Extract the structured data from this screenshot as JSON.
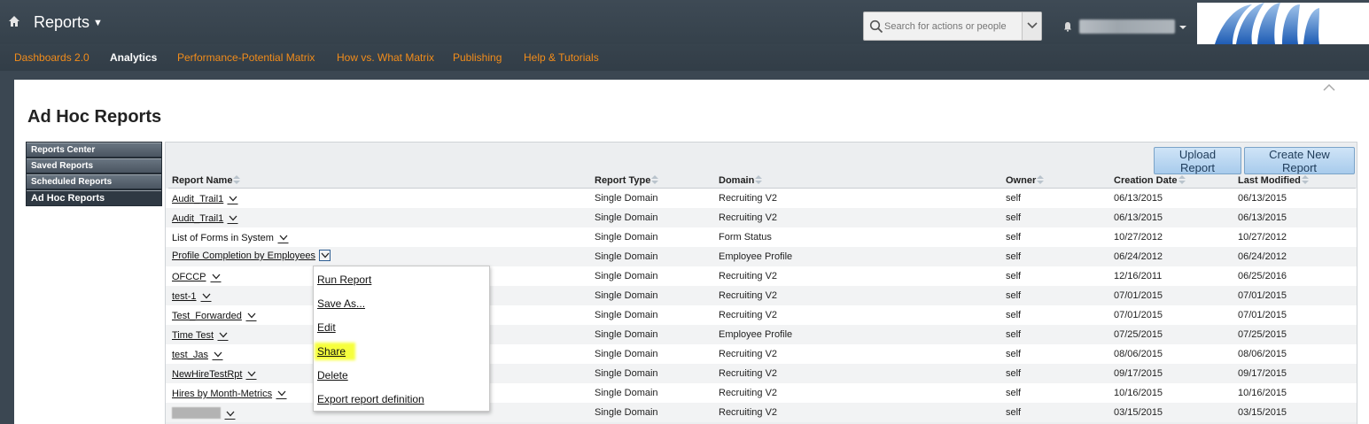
{
  "header": {
    "app_title": "Reports",
    "search_placeholder": "Search for actions or people"
  },
  "nav": {
    "items": [
      {
        "label": "Dashboards 2.0",
        "active": false
      },
      {
        "label": "Analytics",
        "active": true
      },
      {
        "label": "Performance-Potential Matrix",
        "active": false
      },
      {
        "label": "How vs. What Matrix",
        "active": false
      },
      {
        "label": "Publishing",
        "active": false
      },
      {
        "label": "Help & Tutorials",
        "active": false
      }
    ]
  },
  "page": {
    "title": "Ad Hoc Reports"
  },
  "side_menu": {
    "items": [
      {
        "label": "Reports Center"
      },
      {
        "label": "Saved Reports"
      },
      {
        "label": "Scheduled Reports"
      },
      {
        "label": "Ad Hoc Reports",
        "active": true
      }
    ]
  },
  "toolbar": {
    "upload_label": "Upload Report",
    "create_label": "Create New Report"
  },
  "table": {
    "headers": [
      "Report Name",
      "Report Type",
      "Domain",
      "Owner",
      "Creation Date",
      "Last Modified"
    ],
    "rows": [
      {
        "name": "Audit_Trail1",
        "type": "Single Domain",
        "domain": "Recruiting V2",
        "owner": "self",
        "created": "06/13/2015",
        "modified": "06/13/2015"
      },
      {
        "name": "Audit_Trail1",
        "type": "Single Domain",
        "domain": "Recruiting V2",
        "owner": "self",
        "created": "06/13/2015",
        "modified": "06/13/2015"
      },
      {
        "name": "List of Forms in System",
        "type": "Single Domain",
        "domain": "Form Status",
        "owner": "self",
        "created": "10/27/2012",
        "modified": "10/27/2012"
      },
      {
        "name": "Profile Completion by Employees",
        "type": "Single Domain",
        "domain": "Employee Profile",
        "owner": "self",
        "created": "06/24/2012",
        "modified": "06/24/2012"
      },
      {
        "name": "OFCCP",
        "type": "Single Domain",
        "domain": "Recruiting V2",
        "owner": "self",
        "created": "12/16/2011",
        "modified": "06/25/2016"
      },
      {
        "name": "test-1",
        "type": "Single Domain",
        "domain": "Recruiting V2",
        "owner": "self",
        "created": "07/01/2015",
        "modified": "07/01/2015"
      },
      {
        "name": "Test_Forwarded",
        "type": "Single Domain",
        "domain": "Recruiting V2",
        "owner": "self",
        "created": "07/01/2015",
        "modified": "07/01/2015"
      },
      {
        "name": "Time Test",
        "type": "Single Domain",
        "domain": "Employee Profile",
        "owner": "self",
        "created": "07/25/2015",
        "modified": "07/25/2015"
      },
      {
        "name": "test_Jas",
        "type": "Single Domain",
        "domain": "Recruiting V2",
        "owner": "self",
        "created": "08/06/2015",
        "modified": "08/06/2015"
      },
      {
        "name": "NewHireTestRpt",
        "type": "Single Domain",
        "domain": "Recruiting V2",
        "owner": "self",
        "created": "09/17/2015",
        "modified": "09/17/2015"
      },
      {
        "name": "Hires by Month-Metrics",
        "type": "Single Domain",
        "domain": "Recruiting V2",
        "owner": "self",
        "created": "10/16/2015",
        "modified": "10/16/2015"
      },
      {
        "name": "",
        "type": "Single Domain",
        "domain": "Recruiting V2",
        "owner": "self",
        "created": "03/15/2015",
        "modified": "03/15/2015"
      }
    ]
  },
  "context_menu": {
    "items": [
      "Run Report",
      "Save As...",
      "Edit",
      "Share",
      "Delete",
      "Export report definition"
    ],
    "highlighted_item": "Share",
    "highlight_color": "#f6ff3c"
  },
  "colors": {
    "nav_link": "#f28c1a",
    "header_bg": "#3b4752",
    "button_bg": "#b9d7f2"
  }
}
